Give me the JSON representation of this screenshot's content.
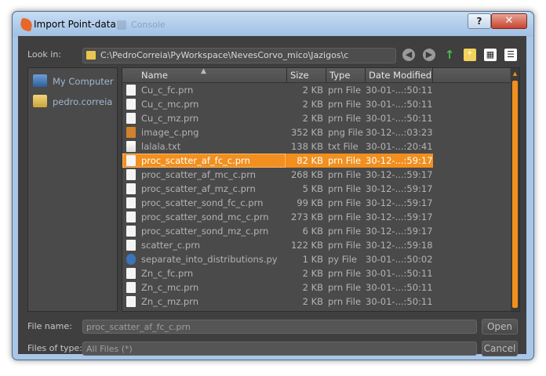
{
  "window": {
    "title": "Import Point-data",
    "background_title": "Console"
  },
  "lookin": {
    "label": "Look in:",
    "path": "C:\\PedroCorreia\\PyWorkspace\\NevesCorvo_mico\\Jazigos\\c"
  },
  "toolbar": {
    "back_icon": "back-icon",
    "forward_icon": "forward-icon",
    "up_icon": "up-arrow-icon",
    "new_folder_icon": "new-folder-icon",
    "detail_view_icon": "detail-view-icon",
    "list_view_icon": "list-view-icon"
  },
  "sidebar": {
    "items": [
      {
        "label": "My Computer",
        "icon": "computer-icon"
      },
      {
        "label": "pedro.correia",
        "icon": "user-folder-icon"
      }
    ]
  },
  "columns": {
    "name": "Name",
    "size": "Size",
    "type": "Type",
    "date": "Date Modified"
  },
  "files": [
    {
      "name": "Cu_c_fc.prn",
      "size": "2 KB",
      "type": "prn File",
      "date": "30-01-...:50:11",
      "icon": "file-icon"
    },
    {
      "name": "Cu_c_mc.prn",
      "size": "2 KB",
      "type": "prn File",
      "date": "30-01-...:50:11",
      "icon": "file-icon"
    },
    {
      "name": "Cu_c_mz.prn",
      "size": "2 KB",
      "type": "prn File",
      "date": "30-01-...:50:11",
      "icon": "file-icon"
    },
    {
      "name": "image_c.png",
      "size": "352 KB",
      "type": "png File",
      "date": "30-12-...:03:23",
      "icon": "image-file-icon"
    },
    {
      "name": "lalala.txt",
      "size": "138 KB",
      "type": "txt File",
      "date": "30-01-...:20:41",
      "icon": "text-file-icon"
    },
    {
      "name": "proc_scatter_af_fc_c.prn",
      "size": "82 KB",
      "type": "prn File",
      "date": "30-12-...:59:17",
      "icon": "file-icon"
    },
    {
      "name": "proc_scatter_af_mc_c.prn",
      "size": "268 KB",
      "type": "prn File",
      "date": "30-12-...:59:17",
      "icon": "file-icon"
    },
    {
      "name": "proc_scatter_af_mz_c.prn",
      "size": "5 KB",
      "type": "prn File",
      "date": "30-12-...:59:17",
      "icon": "file-icon"
    },
    {
      "name": "proc_scatter_sond_fc_c.prn",
      "size": "99 KB",
      "type": "prn File",
      "date": "30-12-...:59:17",
      "icon": "file-icon"
    },
    {
      "name": "proc_scatter_sond_mc_c.prn",
      "size": "273 KB",
      "type": "prn File",
      "date": "30-12-...:59:17",
      "icon": "file-icon"
    },
    {
      "name": "proc_scatter_sond_mz_c.prn",
      "size": "6 KB",
      "type": "prn File",
      "date": "30-12-...:59:17",
      "icon": "file-icon"
    },
    {
      "name": "scatter_c.prn",
      "size": "122 KB",
      "type": "prn File",
      "date": "30-12-...:59:18",
      "icon": "file-icon"
    },
    {
      "name": "separate_into_distributions.py",
      "size": "1 KB",
      "type": "py File",
      "date": "30-01-...:50:02",
      "icon": "python-file-icon"
    },
    {
      "name": "Zn_c_fc.prn",
      "size": "2 KB",
      "type": "prn File",
      "date": "30-01-...:50:11",
      "icon": "file-icon"
    },
    {
      "name": "Zn_c_mc.prn",
      "size": "2 KB",
      "type": "prn File",
      "date": "30-01-...:50:11",
      "icon": "file-icon"
    },
    {
      "name": "Zn_c_mz.prn",
      "size": "2 KB",
      "type": "prn File",
      "date": "30-01-...:50:11",
      "icon": "file-icon"
    }
  ],
  "selected_file": "proc_scatter_af_fc_c.prn",
  "filename": {
    "label": "File name:",
    "value": "proc_scatter_af_fc_c.prn"
  },
  "filetype": {
    "label": "Files of type:",
    "value": "All Files (*)"
  },
  "buttons": {
    "open": "Open",
    "cancel": "Cancel",
    "help": "?",
    "close": "✕"
  },
  "colors": {
    "accent": "#f28f1e",
    "panel": "#4a4a4a",
    "background": "#3f3f3f",
    "frame": "#a9c6e6"
  }
}
